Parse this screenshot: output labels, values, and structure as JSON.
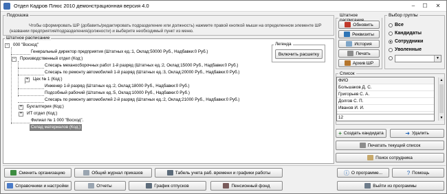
{
  "window": {
    "title": "Отдел Кадров Плюс 2010 демонстрационная версия 4.0",
    "min": "‒",
    "max": "☐",
    "close": "✕"
  },
  "hint": {
    "legend": "Подсказка",
    "text": "Чтобы сформировать ШР (добавить/редактировать подразделение или должность) нажмите правой кнопкой мыши на определенном элементе ШР (названии предприятия/подразделения/должности) и выберите необходимый пункт из меню."
  },
  "tree": {
    "legend": "Штатное расписание",
    "nodes": [
      {
        "label": "000 \"Восход\"",
        "exp": "−"
      },
      {
        "label": "Генеральный директор предприятия (Штатных ед.:1, Оклад:50000 Руб., Надбавки:0 Руб.)"
      },
      {
        "label": "Производственный отдел (Код:)",
        "exp": "−"
      },
      {
        "label": "Слесарь механосборочных работ 1-й разряд (Штатных ед.:2, Оклад:15000 Руб., Надбавки:0 Руб.)"
      },
      {
        "label": "Слесарь по ремонту автомобилей 1-й разряд (Штатных ед.:3, Оклад:20000 Руб., Надбавки:0 Руб.)"
      },
      {
        "label": "Цех № 1 (Код:)",
        "exp": "+"
      },
      {
        "label": "Инженер 1-й разряд (Штатных ед.:2, Оклад:18000 Руб., Надбавки:0 Руб.)"
      },
      {
        "label": "Подсобный рабочий (Штатных ед.:5, Оклад:10000 Руб., Надбавки:0 Руб.)"
      },
      {
        "label": "Слесарь по ремонту автомобилей 2-й разряд (Штатных ед.:2, Оклад:21000 Руб., Надбавки:0 Руб.)"
      },
      {
        "label": "Бухгалтерия (Код:)",
        "exp": "+"
      },
      {
        "label": "ИТ отдел (Код:)",
        "exp": "+"
      },
      {
        "label": "Филиал № 1 000 \"Восход\"."
      },
      {
        "label": "Склад материалов (Код:)"
      }
    ],
    "legend_box": {
      "title": "Легенда",
      "button": "Включить расшетку"
    }
  },
  "shtat": {
    "legend": "Штатное расписание",
    "buttons": [
      "Обновить",
      "Реквизиты",
      "История",
      "Печать",
      "Архив ШР"
    ]
  },
  "group": {
    "legend": "Выбор группы",
    "options": [
      {
        "label": "Все",
        "checked": false
      },
      {
        "label": "Кандидаты",
        "checked": false
      },
      {
        "label": "Сотрудники",
        "checked": true
      },
      {
        "label": "Уволенные",
        "checked": false
      }
    ]
  },
  "list": {
    "legend": "Список",
    "header": "ФИО",
    "rows": [
      "Большаков Д. С.",
      "Григорьев С. А.",
      "Долгов С. П.",
      "Иванов И. И."
    ],
    "count": "12"
  },
  "actions": {
    "create_candidate": "Создать кандидата",
    "delete": "Удалить",
    "print_list": "Печатать текущий список",
    "search_employee": "Поиск сотрудника",
    "about": "О программе...",
    "help": "Помощь",
    "exit": "Выйти из программы"
  },
  "bottom": {
    "change_org": "Сменить организацию",
    "orders_journal": "Общий журнал приказов",
    "timesheet": "Табель учета раб. времени и графики работы",
    "directories": "Справочники и настройки",
    "reports": "Отчеты",
    "vacation": "График отпусков",
    "pension": "Пенсионный фонд"
  },
  "colors": {
    "selected_bg": "#7f7f7f",
    "window_bg": "#f0f0f0"
  }
}
